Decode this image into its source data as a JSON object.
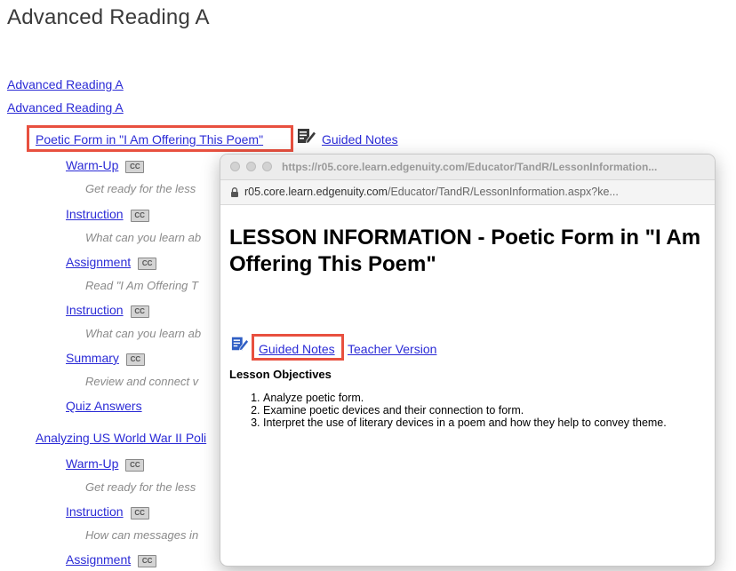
{
  "page": {
    "title": "Advanced Reading A"
  },
  "course_links": [
    "Advanced Reading A",
    "Advanced Reading A"
  ],
  "lesson1": {
    "title": "Poetic Form in \"I Am Offering This Poem\"",
    "guided_notes": "Guided Notes",
    "items": [
      {
        "label": "Warm-Up",
        "desc": "Get ready for the less"
      },
      {
        "label": "Instruction",
        "desc": "What can you learn ab"
      },
      {
        "label": "Assignment",
        "desc": "Read \"I Am Offering T"
      },
      {
        "label": "Instruction",
        "desc": "What can you learn ab"
      },
      {
        "label": "Summary",
        "desc": "Review and connect v"
      }
    ],
    "quiz_answers": "Quiz Answers"
  },
  "lesson2": {
    "title": "Analyzing US World War II Poli",
    "items": [
      {
        "label": "Warm-Up",
        "desc": "Get ready for the less"
      },
      {
        "label": "Instruction",
        "desc": "How can messages in"
      },
      {
        "label": "Assignment",
        "desc": ""
      }
    ]
  },
  "cc_label": "CC",
  "popup": {
    "window_title_url": "https://r05.core.learn.edgenuity.com/Educator/TandR/LessonInformation...",
    "address_host": "r05.core.learn.edgenuity.com",
    "address_path": "/Educator/TandR/LessonInformation.aspx?ke...",
    "heading": "LESSON INFORMATION - Poetic Form in \"I Am Offering This Poem\"",
    "guided_notes": "Guided Notes",
    "teacher_version": "Teacher Version",
    "objectives_heading": "Lesson Objectives",
    "objectives": [
      "Analyze poetic form.",
      "Examine poetic devices and their connection to form.",
      "Interpret the use of literary devices in a poem and how they help to convey theme."
    ]
  },
  "colors": {
    "link": "#2b2bd6",
    "highlight": "#e8503f",
    "description": "#8a8a8a"
  },
  "icons": [
    "notes-pencil-icon",
    "lock-icon",
    "cc-icon"
  ]
}
